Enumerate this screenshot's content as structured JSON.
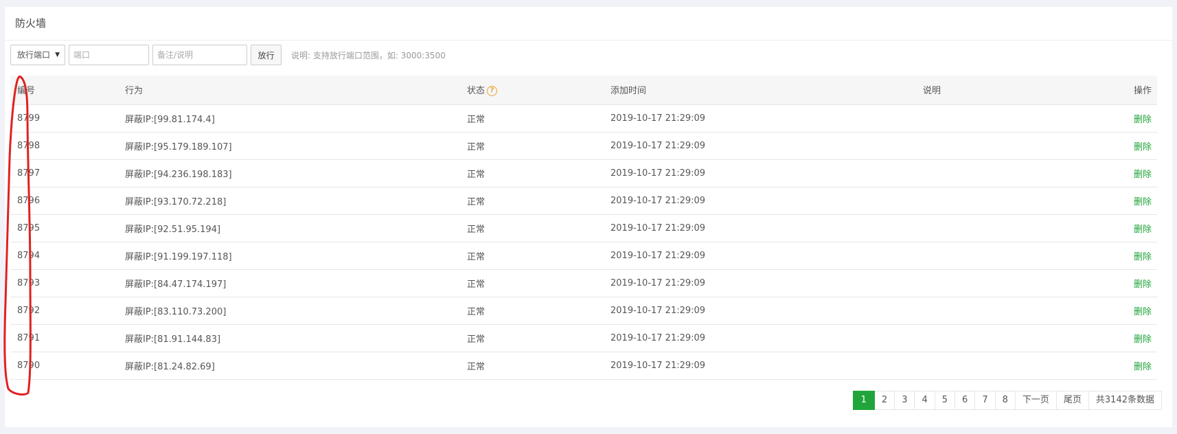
{
  "panel": {
    "title": "防火墙"
  },
  "toolbar": {
    "select_value": "放行端口",
    "port_placeholder": "端口",
    "note_placeholder": "备注/说明",
    "submit_label": "放行",
    "hint": "说明: 支持放行端口范围，如: 3000:3500"
  },
  "table": {
    "headers": {
      "id": "编号",
      "action": "行为",
      "status": "状态",
      "time": "添加时间",
      "note": "说明",
      "op": "操作"
    },
    "rows": [
      {
        "id": "8799",
        "action": "屏蔽IP:[99.81.174.4]",
        "status": "正常",
        "time": "2019-10-17 21:29:09",
        "note": "",
        "op": "删除"
      },
      {
        "id": "8798",
        "action": "屏蔽IP:[95.179.189.107]",
        "status": "正常",
        "time": "2019-10-17 21:29:09",
        "note": "",
        "op": "删除"
      },
      {
        "id": "8797",
        "action": "屏蔽IP:[94.236.198.183]",
        "status": "正常",
        "time": "2019-10-17 21:29:09",
        "note": "",
        "op": "删除"
      },
      {
        "id": "8796",
        "action": "屏蔽IP:[93.170.72.218]",
        "status": "正常",
        "time": "2019-10-17 21:29:09",
        "note": "",
        "op": "删除"
      },
      {
        "id": "8795",
        "action": "屏蔽IP:[92.51.95.194]",
        "status": "正常",
        "time": "2019-10-17 21:29:09",
        "note": "",
        "op": "删除"
      },
      {
        "id": "8794",
        "action": "屏蔽IP:[91.199.197.118]",
        "status": "正常",
        "time": "2019-10-17 21:29:09",
        "note": "",
        "op": "删除"
      },
      {
        "id": "8793",
        "action": "屏蔽IP:[84.47.174.197]",
        "status": "正常",
        "time": "2019-10-17 21:29:09",
        "note": "",
        "op": "删除"
      },
      {
        "id": "8792",
        "action": "屏蔽IP:[83.110.73.200]",
        "status": "正常",
        "time": "2019-10-17 21:29:09",
        "note": "",
        "op": "删除"
      },
      {
        "id": "8791",
        "action": "屏蔽IP:[81.91.144.83]",
        "status": "正常",
        "time": "2019-10-17 21:29:09",
        "note": "",
        "op": "删除"
      },
      {
        "id": "8790",
        "action": "屏蔽IP:[81.24.82.69]",
        "status": "正常",
        "time": "2019-10-17 21:29:09",
        "note": "",
        "op": "删除"
      }
    ]
  },
  "pagination": {
    "pages": [
      "1",
      "2",
      "3",
      "4",
      "5",
      "6",
      "7",
      "8"
    ],
    "current": "1",
    "next": "下一页",
    "last": "尾页",
    "total": "共3142条数据"
  },
  "icons": {
    "status_help": "help-circle-icon",
    "select_caret": "caret-down-icon"
  },
  "colors": {
    "accent": "#20a53a",
    "help": "#f0a030",
    "annotation": "#e02020"
  }
}
